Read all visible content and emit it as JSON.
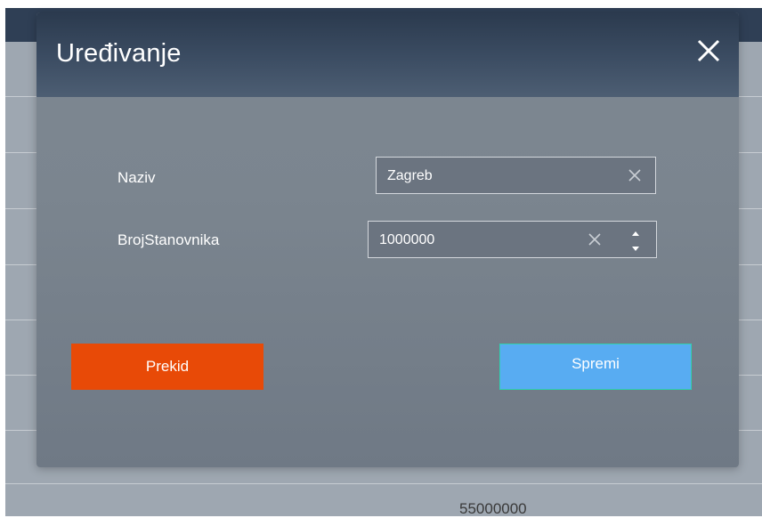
{
  "modal": {
    "title": "Uređivanje",
    "close_icon": "close-icon"
  },
  "form": {
    "naziv": {
      "label": "Naziv",
      "value": "Zagreb",
      "clear_icon": "clear-icon"
    },
    "broj_stanovnika": {
      "label": "BrojStanovnika",
      "value": "1000000",
      "clear_icon": "clear-icon",
      "spinner_icons": [
        "caret-up-icon",
        "caret-down-icon"
      ]
    }
  },
  "buttons": {
    "cancel_label": "Prekid",
    "save_label": "Spremi"
  },
  "colors": {
    "cancel": "#e84a07",
    "save": "#58acf2",
    "save_border": "#2ed1b0",
    "header": "#2f3f55"
  },
  "background_table": {
    "visible_cell": "55000000"
  }
}
